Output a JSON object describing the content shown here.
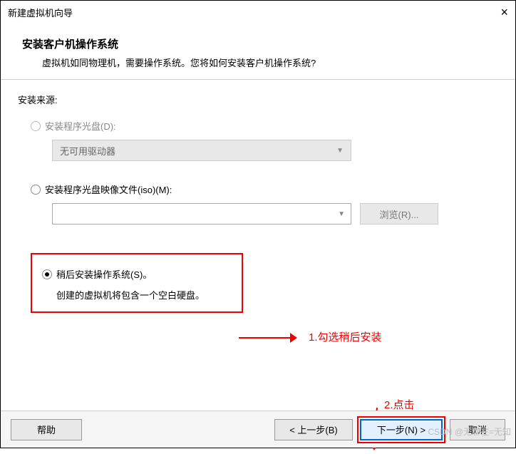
{
  "window": {
    "title": "新建虚拟机向导"
  },
  "header": {
    "title": "安装客户机操作系统",
    "subtitle": "虚拟机如同物理机，需要操作系统。您将如何安装客户机操作系统?"
  },
  "source": {
    "label": "安装来源:",
    "disc": {
      "label": "安装程序光盘(D):",
      "dropdown": "无可用驱动器"
    },
    "iso": {
      "label": "安装程序光盘映像文件(iso)(M):",
      "browse": "浏览(R)..."
    },
    "later": {
      "label": "稍后安装操作系统(S)。",
      "desc": "创建的虚拟机将包含一个空白硬盘。"
    }
  },
  "annotations": {
    "a1": "1.勾选稍后安装",
    "a2": "2.点击"
  },
  "footer": {
    "help": "帮助",
    "back": "< 上一步(B)",
    "next": "下一步(N) >",
    "cancel": "取消"
  },
  "watermark": "CSDN @无聊在=无知"
}
